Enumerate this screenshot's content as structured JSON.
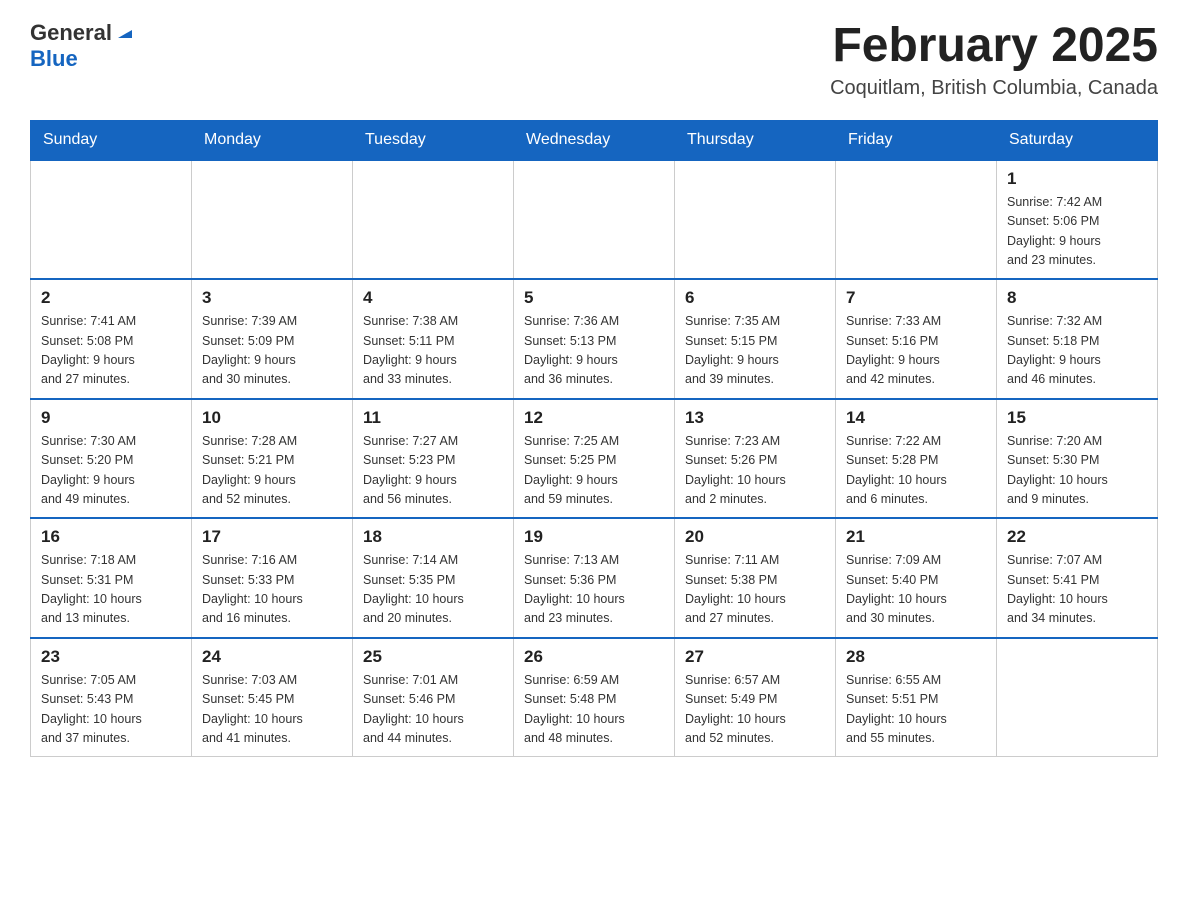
{
  "header": {
    "logo_general": "General",
    "logo_blue": "Blue",
    "month_title": "February 2025",
    "location": "Coquitlam, British Columbia, Canada"
  },
  "weekdays": [
    "Sunday",
    "Monday",
    "Tuesday",
    "Wednesday",
    "Thursday",
    "Friday",
    "Saturday"
  ],
  "weeks": [
    [
      {
        "day": "",
        "info": ""
      },
      {
        "day": "",
        "info": ""
      },
      {
        "day": "",
        "info": ""
      },
      {
        "day": "",
        "info": ""
      },
      {
        "day": "",
        "info": ""
      },
      {
        "day": "",
        "info": ""
      },
      {
        "day": "1",
        "info": "Sunrise: 7:42 AM\nSunset: 5:06 PM\nDaylight: 9 hours\nand 23 minutes."
      }
    ],
    [
      {
        "day": "2",
        "info": "Sunrise: 7:41 AM\nSunset: 5:08 PM\nDaylight: 9 hours\nand 27 minutes."
      },
      {
        "day": "3",
        "info": "Sunrise: 7:39 AM\nSunset: 5:09 PM\nDaylight: 9 hours\nand 30 minutes."
      },
      {
        "day": "4",
        "info": "Sunrise: 7:38 AM\nSunset: 5:11 PM\nDaylight: 9 hours\nand 33 minutes."
      },
      {
        "day": "5",
        "info": "Sunrise: 7:36 AM\nSunset: 5:13 PM\nDaylight: 9 hours\nand 36 minutes."
      },
      {
        "day": "6",
        "info": "Sunrise: 7:35 AM\nSunset: 5:15 PM\nDaylight: 9 hours\nand 39 minutes."
      },
      {
        "day": "7",
        "info": "Sunrise: 7:33 AM\nSunset: 5:16 PM\nDaylight: 9 hours\nand 42 minutes."
      },
      {
        "day": "8",
        "info": "Sunrise: 7:32 AM\nSunset: 5:18 PM\nDaylight: 9 hours\nand 46 minutes."
      }
    ],
    [
      {
        "day": "9",
        "info": "Sunrise: 7:30 AM\nSunset: 5:20 PM\nDaylight: 9 hours\nand 49 minutes."
      },
      {
        "day": "10",
        "info": "Sunrise: 7:28 AM\nSunset: 5:21 PM\nDaylight: 9 hours\nand 52 minutes."
      },
      {
        "day": "11",
        "info": "Sunrise: 7:27 AM\nSunset: 5:23 PM\nDaylight: 9 hours\nand 56 minutes."
      },
      {
        "day": "12",
        "info": "Sunrise: 7:25 AM\nSunset: 5:25 PM\nDaylight: 9 hours\nand 59 minutes."
      },
      {
        "day": "13",
        "info": "Sunrise: 7:23 AM\nSunset: 5:26 PM\nDaylight: 10 hours\nand 2 minutes."
      },
      {
        "day": "14",
        "info": "Sunrise: 7:22 AM\nSunset: 5:28 PM\nDaylight: 10 hours\nand 6 minutes."
      },
      {
        "day": "15",
        "info": "Sunrise: 7:20 AM\nSunset: 5:30 PM\nDaylight: 10 hours\nand 9 minutes."
      }
    ],
    [
      {
        "day": "16",
        "info": "Sunrise: 7:18 AM\nSunset: 5:31 PM\nDaylight: 10 hours\nand 13 minutes."
      },
      {
        "day": "17",
        "info": "Sunrise: 7:16 AM\nSunset: 5:33 PM\nDaylight: 10 hours\nand 16 minutes."
      },
      {
        "day": "18",
        "info": "Sunrise: 7:14 AM\nSunset: 5:35 PM\nDaylight: 10 hours\nand 20 minutes."
      },
      {
        "day": "19",
        "info": "Sunrise: 7:13 AM\nSunset: 5:36 PM\nDaylight: 10 hours\nand 23 minutes."
      },
      {
        "day": "20",
        "info": "Sunrise: 7:11 AM\nSunset: 5:38 PM\nDaylight: 10 hours\nand 27 minutes."
      },
      {
        "day": "21",
        "info": "Sunrise: 7:09 AM\nSunset: 5:40 PM\nDaylight: 10 hours\nand 30 minutes."
      },
      {
        "day": "22",
        "info": "Sunrise: 7:07 AM\nSunset: 5:41 PM\nDaylight: 10 hours\nand 34 minutes."
      }
    ],
    [
      {
        "day": "23",
        "info": "Sunrise: 7:05 AM\nSunset: 5:43 PM\nDaylight: 10 hours\nand 37 minutes."
      },
      {
        "day": "24",
        "info": "Sunrise: 7:03 AM\nSunset: 5:45 PM\nDaylight: 10 hours\nand 41 minutes."
      },
      {
        "day": "25",
        "info": "Sunrise: 7:01 AM\nSunset: 5:46 PM\nDaylight: 10 hours\nand 44 minutes."
      },
      {
        "day": "26",
        "info": "Sunrise: 6:59 AM\nSunset: 5:48 PM\nDaylight: 10 hours\nand 48 minutes."
      },
      {
        "day": "27",
        "info": "Sunrise: 6:57 AM\nSunset: 5:49 PM\nDaylight: 10 hours\nand 52 minutes."
      },
      {
        "day": "28",
        "info": "Sunrise: 6:55 AM\nSunset: 5:51 PM\nDaylight: 10 hours\nand 55 minutes."
      },
      {
        "day": "",
        "info": ""
      }
    ]
  ]
}
